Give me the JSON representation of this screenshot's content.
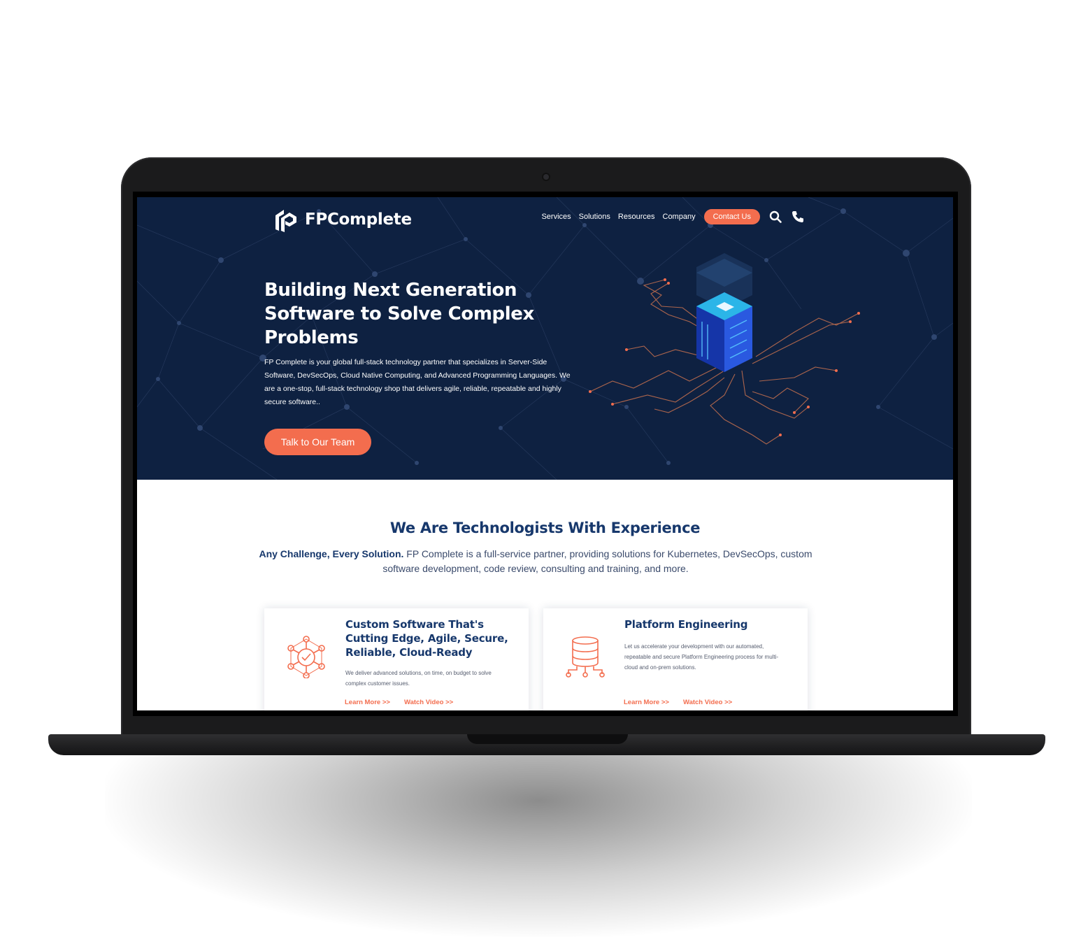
{
  "brand": {
    "name": "FPComplete",
    "accent_color": "#f36d4e",
    "navy_color": "#0e2141",
    "heading_color": "#17386c"
  },
  "nav": {
    "links": [
      "Services",
      "Solutions",
      "Resources",
      "Company"
    ],
    "contact_label": "Contact Us",
    "icons": [
      "search-icon",
      "phone-icon"
    ]
  },
  "hero": {
    "title": "Building Next Generation Software to Solve Complex Problems",
    "description": "FP Complete is your global full-stack technology partner that specializes in Server-Side Software, DevSecOps, Cloud Native Computing, and Advanced Programming Languages. We are a one-stop, full-stack technology shop that delivers agile, reliable, repeatable and highly secure software..",
    "cta_label": "Talk to Our Team"
  },
  "intro": {
    "title": "We Are Technologists With Experience",
    "lead": "Any Challenge, Every Solution.",
    "body": " FP Complete is a full-service partner, providing solutions for Kubernetes, DevSecOps, custom software development, code review, consulting and training, and more."
  },
  "cards": [
    {
      "icon": "network-check-icon",
      "title": "Custom Software That's Cutting Edge, Agile, Secure, Reliable, Cloud-Ready",
      "description": "We deliver advanced solutions, on time, on budget to solve complex customer issues.",
      "learn_more": "Learn More >>",
      "watch_video": "Watch Video >>"
    },
    {
      "icon": "database-icon",
      "title": "Platform Engineering",
      "description": "Let us accelerate your development with our automated, repeatable and secure Platform Engineering process for multi-cloud and on-prem solutions.",
      "learn_more": "Learn More >>",
      "watch_video": "Watch Video >>"
    }
  ]
}
